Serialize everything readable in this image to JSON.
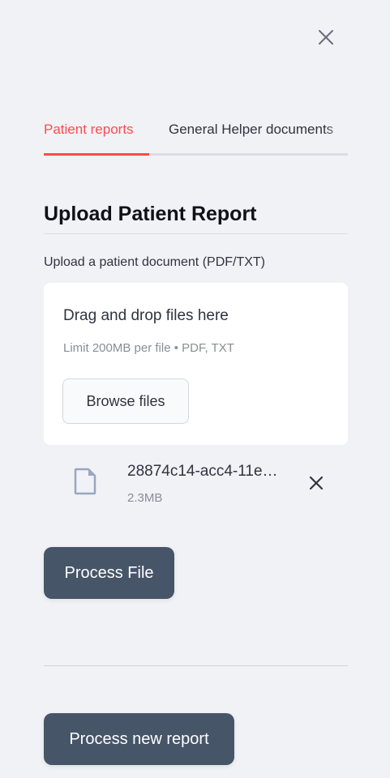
{
  "tabs": [
    {
      "label": "Patient reports",
      "active": true
    },
    {
      "label": "General Helper documents",
      "active": false
    }
  ],
  "section_title": "Upload Patient Report",
  "uploader": {
    "label": "Upload a patient document (PDF/TXT)",
    "drag_text": "Drag and drop files here",
    "limit_text": "Limit 200MB per file • PDF, TXT",
    "browse_label": "Browse files"
  },
  "file": {
    "name": "28874c14-acc4-11e…",
    "size": "2.3MB",
    "icon": "file-icon"
  },
  "buttons": {
    "process_file": "Process File",
    "process_new_report": "Process new report"
  },
  "colors": {
    "accent": "#ff4b4b",
    "button": "#475569",
    "background": "#f0f2f6"
  }
}
